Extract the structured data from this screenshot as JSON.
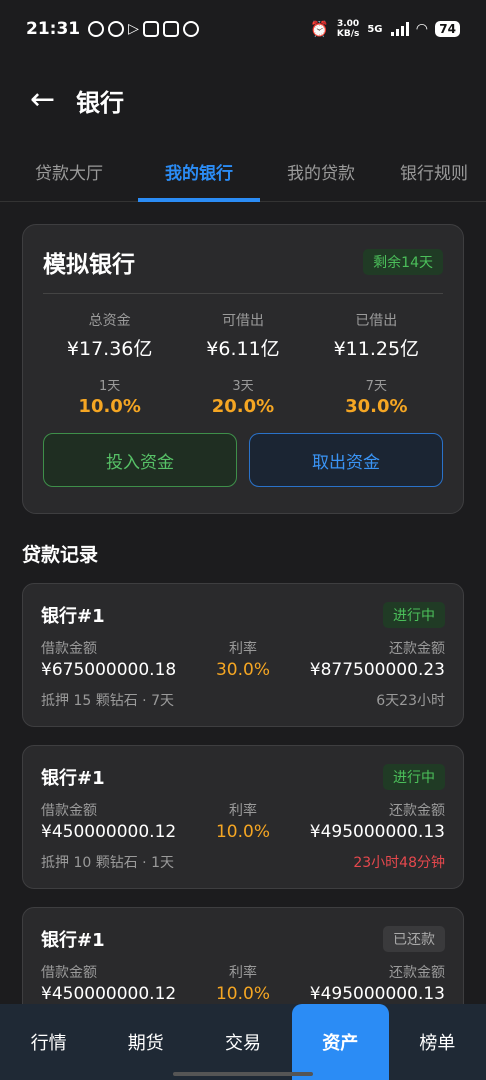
{
  "status_bar": {
    "time": "21:31",
    "net_speed": "3.00",
    "net_unit": "KB/s",
    "network": "5G",
    "battery": "74"
  },
  "header": {
    "title": "银行"
  },
  "tabs": [
    {
      "label": "贷款大厅"
    },
    {
      "label": "我的银行"
    },
    {
      "label": "我的贷款"
    },
    {
      "label": "银行规则"
    }
  ],
  "bank": {
    "name": "模拟银行",
    "badge": "剩余14天",
    "stats": [
      {
        "label": "总资金",
        "value": "¥17.36亿"
      },
      {
        "label": "可借出",
        "value": "¥6.11亿"
      },
      {
        "label": "已借出",
        "value": "¥11.25亿"
      }
    ],
    "rates": [
      {
        "label": "1天",
        "value": "10.0%"
      },
      {
        "label": "3天",
        "value": "20.0%"
      },
      {
        "label": "7天",
        "value": "30.0%"
      }
    ],
    "invest_label": "投入资金",
    "withdraw_label": "取出资金"
  },
  "records": {
    "title": "贷款记录",
    "items": [
      {
        "name": "银行#1",
        "status": "进行中",
        "loan_label": "借款金额",
        "loan_value": "¥675000000.18",
        "rate_label": "利率",
        "rate_value": "30.0%",
        "repay_label": "还款金额",
        "repay_value": "¥877500000.23",
        "collateral": "抵押 15 颗钻石 · 7天",
        "remaining": "6天23小时"
      },
      {
        "name": "银行#1",
        "status": "进行中",
        "loan_label": "借款金额",
        "loan_value": "¥450000000.12",
        "rate_label": "利率",
        "rate_value": "10.0%",
        "repay_label": "还款金额",
        "repay_value": "¥495000000.13",
        "collateral": "抵押 10 颗钻石 · 1天",
        "remaining": "23小时48分钟"
      },
      {
        "name": "银行#1",
        "status": "已还款",
        "loan_label": "借款金额",
        "loan_value": "¥450000000.12",
        "rate_label": "利率",
        "rate_value": "10.0%",
        "repay_label": "还款金额",
        "repay_value": "¥495000000.13"
      }
    ]
  },
  "bottom_nav": [
    {
      "label": "行情"
    },
    {
      "label": "期货"
    },
    {
      "label": "交易"
    },
    {
      "label": "资产"
    },
    {
      "label": "榜单"
    }
  ]
}
